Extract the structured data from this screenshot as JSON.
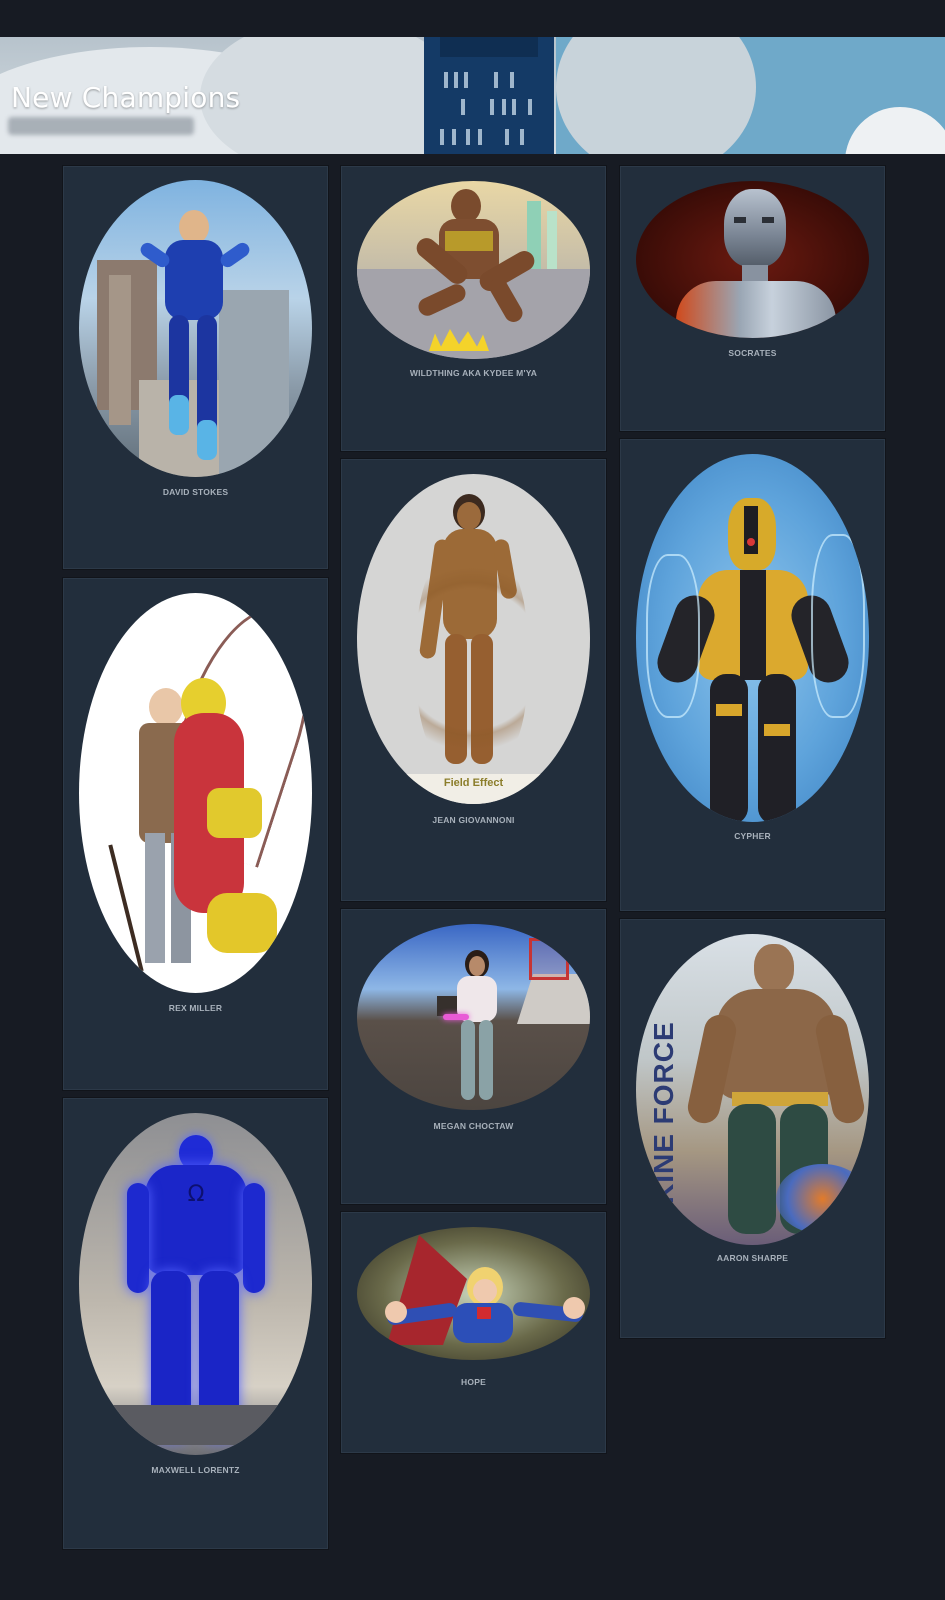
{
  "page": {
    "title": "New Champions"
  },
  "champions": [
    {
      "name": "DAVID STOKES"
    },
    {
      "name": "WILDTHING AKA KYDEE M'YA"
    },
    {
      "name": "SOCRATES"
    },
    {
      "name": "JEAN GIOVANNONI"
    },
    {
      "name": "CYPHER"
    },
    {
      "name": "REX MILLER"
    },
    {
      "name": "MEGAN CHOCTAW"
    },
    {
      "name": "AARON SHARPE"
    },
    {
      "name": "MAXWELL LORENTZ"
    },
    {
      "name": "HOPE"
    }
  ],
  "image_captions": {
    "field_effect": "Field Effect",
    "kine_force": "KINE FORCE"
  }
}
